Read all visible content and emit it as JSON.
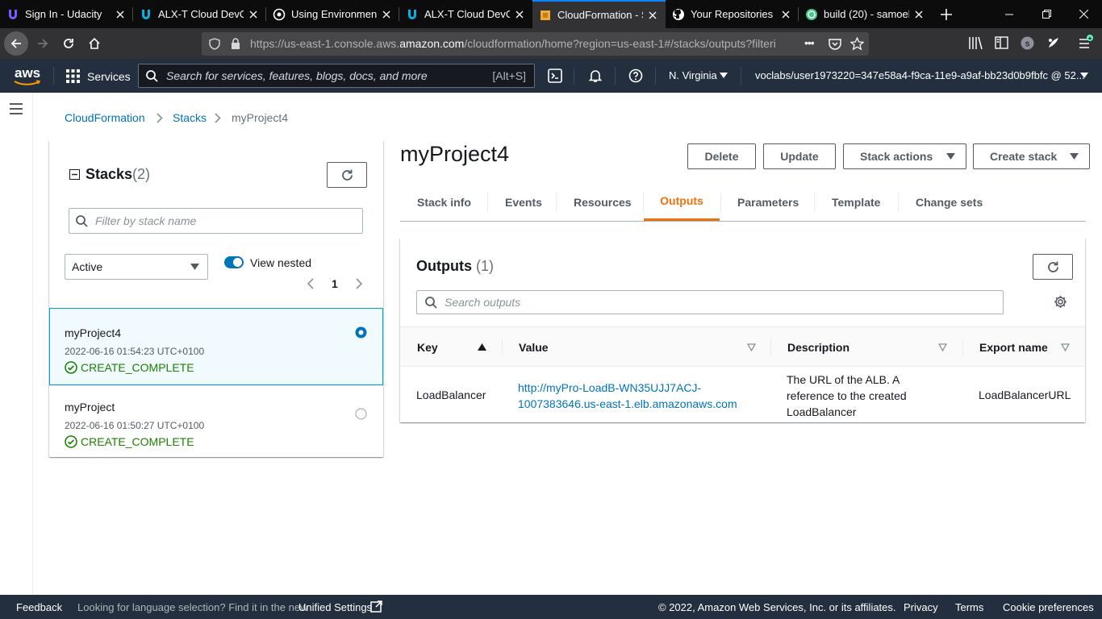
{
  "browser": {
    "tabs": [
      {
        "title": "Sign In - Udacity",
        "icon": "udacity-icon",
        "active": false
      },
      {
        "title": "ALX-T Cloud DevOp",
        "icon": "udacity-icon",
        "active": false
      },
      {
        "title": "Using Environment",
        "icon": "circle-dot-icon",
        "active": false
      },
      {
        "title": "ALX-T Cloud DevOp",
        "icon": "udacity-icon",
        "active": false
      },
      {
        "title": "CloudFormation - S",
        "icon": "cloudformation-icon",
        "active": true
      },
      {
        "title": "Your Repositories",
        "icon": "github-icon",
        "active": false
      },
      {
        "title": "build (20) - samoek",
        "icon": "build-status-icon",
        "active": false
      }
    ],
    "url_prefix": "https://us-east-1.console.aws.",
    "url_domain": "amazon.com",
    "url_suffix": "/cloudformation/home?region=us-east-1#/stacks/outputs?filteri",
    "url_more": "•••"
  },
  "aws_nav": {
    "logo": "aws",
    "services_label": "Services",
    "search_placeholder": "Search for services, features, blogs, docs, and more",
    "search_shortcut": "[Alt+S]",
    "region": "N. Virginia",
    "account": "voclabs/user1973220=347e58a4-f9ca-11e9-a9af-bb23d0b9fbfc @ 52..."
  },
  "breadcrumb": {
    "items": [
      "CloudFormation",
      "Stacks",
      "myProject4"
    ]
  },
  "stacks_panel": {
    "title": "Stacks",
    "count": "(2)",
    "filter_placeholder": "Filter by stack name",
    "status_filter": "Active",
    "view_nested_label": "View nested",
    "view_nested_on": true,
    "page": "1",
    "stacks": [
      {
        "name": "myProject4",
        "time": "2022-06-16 01:54:23 UTC+0100",
        "status": "CREATE_COMPLETE",
        "selected": true
      },
      {
        "name": "myProject",
        "time": "2022-06-16 01:50:27 UTC+0100",
        "status": "CREATE_COMPLETE",
        "selected": false
      }
    ]
  },
  "stack_detail": {
    "title": "myProject4",
    "buttons": {
      "delete": "Delete",
      "update": "Update",
      "stack_actions": "Stack actions",
      "create_stack": "Create stack"
    },
    "tabs": [
      "Stack info",
      "Events",
      "Resources",
      "Outputs",
      "Parameters",
      "Template",
      "Change sets"
    ],
    "active_tab": "Outputs"
  },
  "outputs": {
    "title": "Outputs",
    "count": "(1)",
    "search_placeholder": "Search outputs",
    "columns": [
      "Key",
      "Value",
      "Description",
      "Export name"
    ],
    "rows": [
      {
        "key": "LoadBalancer",
        "value_line1": "http://myPro-LoadB-WN35UJJ7ACJ-",
        "value_line2": "1007383646.us-east-1.elb.amazonaws.com",
        "description_line1": "The URL of the ALB. A",
        "description_line2": "reference to the created",
        "description_line3": "LoadBalancer",
        "export_name": "LoadBalancerURL"
      }
    ]
  },
  "footer": {
    "feedback": "Feedback",
    "language_prefix": "Looking for language selection? Find it in the new",
    "language_link": "Unified Settings",
    "copyright": "© 2022, Amazon Web Services, Inc. or its affiliates.",
    "privacy": "Privacy",
    "terms": "Terms",
    "cookies": "Cookie preferences"
  },
  "colors": {
    "aws_nav": "#232f3e",
    "link": "#0073bb",
    "active_tab": "#ec7211",
    "success": "#1d8102",
    "selected_bg": "#f1faff"
  }
}
